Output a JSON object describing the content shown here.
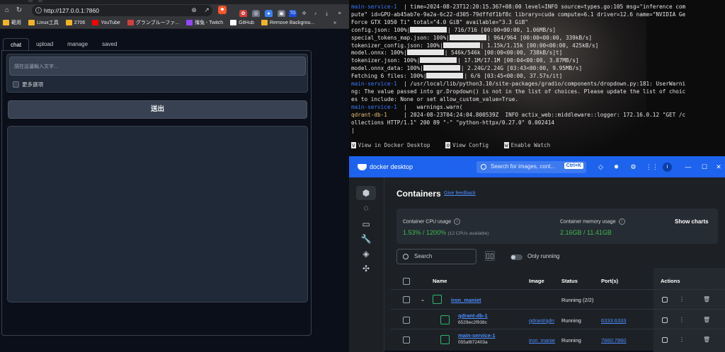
{
  "browser": {
    "url": "http://127.0.0.1:7860",
    "bookmarks": [
      {
        "label": "範用",
        "color": "#f0b429"
      },
      {
        "label": "Linux工具",
        "color": "#f0b429"
      },
      {
        "label": "2706",
        "color": "#f0b429"
      },
      {
        "label": "YouTube",
        "color": "#ff0000"
      },
      {
        "label": "グランブルーファ...",
        "color": "#d23f3f"
      },
      {
        "label": "殭兔 - Twitch",
        "color": "#9146ff"
      },
      {
        "label": "GitHub",
        "color": "#ffffff"
      },
      {
        "label": "Remove Backgrou...",
        "color": "#f0b429"
      }
    ],
    "more": "»"
  },
  "gradio": {
    "tabs": [
      "chat",
      "upload",
      "manage",
      "saved"
    ],
    "textbox_placeholder": "請在這邊輸入文字...",
    "more_options": "更多選項",
    "send_label": "送出"
  },
  "terminal": {
    "lines": [
      [
        {
          "t": "main-service-1",
          "c": "blue"
        },
        {
          "t": "  | time=2024-08-23T12:20:15.367+08:00 level=INFO source=types.go:105 msg=\"inference com"
        }
      ],
      [
        {
          "t": "pute\" id=GPU-ab45ab7e-9a2a-6c22-d305-79dffdf1bf8c library=cuda compute=6.1 driver=12.6 name=\"NVIDIA Ge"
        }
      ],
      [
        {
          "t": "Force GTX 1050 Ti\" total=\"4.0 GiB\" available=\"3.3 GiB\""
        }
      ],
      [
        {
          "t": "config.json: 100%|"
        },
        {
          "bar": true
        },
        {
          "t": "| 716/716 [00:00<00:00, 1.06MB/s]"
        }
      ],
      [
        {
          "t": "special_tokens_map.json: 100%|"
        },
        {
          "bar": true
        },
        {
          "t": "| 964/964 [00:00<00:00, 339kB/s]"
        }
      ],
      [
        {
          "t": "tokenizer_config.json: 100%|"
        },
        {
          "bar": true
        },
        {
          "t": "| 1.15k/1.15k [00:00<00:00, 425kB/s]"
        }
      ],
      [
        {
          "t": "model.onnx: 100%|"
        },
        {
          "bar": true
        },
        {
          "t": "| 546k/546k [00:00<00:00, 738kB/s]t]"
        }
      ],
      [
        {
          "t": "tokenizer.json: 100%|"
        },
        {
          "bar": true
        },
        {
          "t": "| 17.1M/17.1M [00:04<00:00, 3.87MB/s]"
        }
      ],
      [
        {
          "t": "model.onnx_data: 100%|"
        },
        {
          "bar": true
        },
        {
          "t": "| 2.24G/2.24G [03:43<00:00, 9.95MB/s]"
        }
      ],
      [
        {
          "t": "Fetching 6 files: 100%|"
        },
        {
          "bar": true
        },
        {
          "t": "| 6/6 [03:45<00:00, 37.57s/it]"
        }
      ],
      [
        {
          "t": "main-service-1",
          "c": "blue"
        },
        {
          "t": "  | /usr/local/lib/python3.10/site-packages/gradio/components/dropdown.py:181: UserWarni"
        }
      ],
      [
        {
          "t": "ng: The value passed into gr.Dropdown() is not in the list of choices. Please update the list of choic"
        }
      ],
      [
        {
          "t": "es to include: None or set allow_custom_value=True."
        }
      ],
      [
        {
          "t": "main-service-1",
          "c": "blue"
        },
        {
          "t": "  |   warnings.warn("
        }
      ],
      [
        {
          "t": "qdrant-db-1",
          "c": "yellow"
        },
        {
          "t": "     | 2024-08-23T04:24:04.800539Z  INFO actix_web::middleware::logger: 172.16.0.12 \"GET /c"
        }
      ],
      [
        {
          "t": "ollections HTTP/1.1\" 200 89 \"-\" \"python-httpx/0.27.0\" 0.002414"
        }
      ],
      [
        {
          "t": "|"
        }
      ]
    ],
    "footer": [
      {
        "key": "v",
        "label": "View in Docker Desktop"
      },
      {
        "key": "o",
        "label": "View Config"
      },
      {
        "key": "w",
        "label": "Enable Watch"
      }
    ]
  },
  "docker": {
    "app_name": "docker desktop",
    "search_placeholder": "Search for images, cont...",
    "search_shortcut": "Ctrl+K",
    "avatar_letter": "I",
    "page_title": "Containers",
    "feedback": "Give feedback",
    "cpu_label": "Container CPU usage",
    "cpu_value": "1.53% / 1200%",
    "cpu_note": "(12 CPUs available)",
    "mem_label": "Container memory usage",
    "mem_value": "2.16GB / 11.41GB",
    "show_charts": "Show charts",
    "search": "Search",
    "only_running": "Only running",
    "columns": {
      "name": "Name",
      "image": "Image",
      "status": "Status",
      "ports": "Port(s)",
      "actions": "Actions"
    },
    "rows": [
      {
        "name": "iron_maniet",
        "id": "",
        "image": "",
        "status": "Running (2/2)",
        "port": ""
      },
      {
        "name": "qdrant-db-1",
        "id": "6529ec2f938c",
        "image": "qdrant/qdn",
        "status": "Running",
        "port": "6333:6333"
      },
      {
        "name": "main-service-1",
        "id": "055af872403a",
        "image": "iron_manie",
        "status": "Running",
        "port": "7860:7860"
      }
    ],
    "colors": {
      "accent": "#1d63ed",
      "running": "#2ab673",
      "link": "#4c8cff"
    }
  }
}
